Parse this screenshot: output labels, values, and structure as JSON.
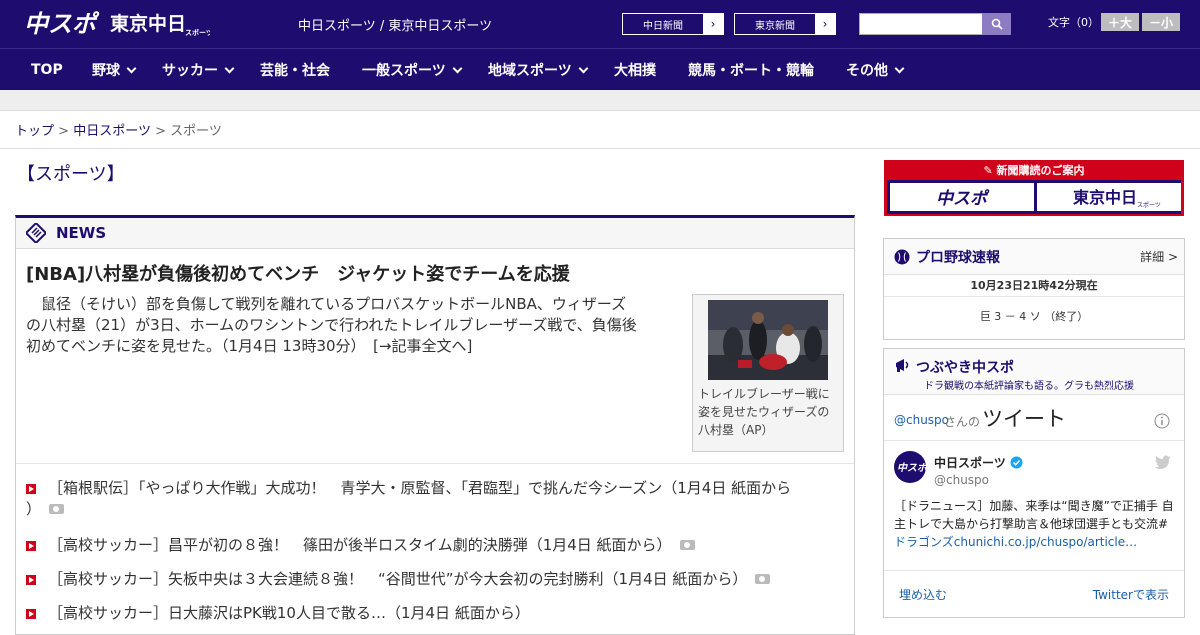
{
  "header": {
    "logo_chuspo": "中スポ",
    "logo_tokyo_main": "東京中日",
    "logo_tokyo_sub": "スポーツ",
    "site_title": "中日スポーツ / 東京中日スポーツ",
    "paper_links": [
      "中日新聞",
      "東京新聞"
    ],
    "search_placeholder": "",
    "font_size_label": "文字（0）",
    "font_plus": "＋大",
    "font_minus": "－小"
  },
  "nav": [
    {
      "label": "TOP",
      "has_menu": false
    },
    {
      "label": "野球",
      "has_menu": true
    },
    {
      "label": "サッカー",
      "has_menu": true
    },
    {
      "label": "芸能・社会",
      "has_menu": false
    },
    {
      "label": "一般スポーツ",
      "has_menu": true
    },
    {
      "label": "地域スポーツ",
      "has_menu": true
    },
    {
      "label": "大相撲",
      "has_menu": false
    },
    {
      "label": "競馬・ボート・競輪",
      "has_menu": false
    },
    {
      "label": "その他",
      "has_menu": true
    }
  ],
  "breadcrumb": {
    "items": [
      "トップ",
      "中日スポーツ",
      "スポーツ"
    ],
    "separator": ">"
  },
  "page_heading": "【スポーツ】",
  "news": {
    "section_label": "NEWS",
    "headline": "[NBA]八村塁が負傷後初めてベンチ　ジャケット姿でチームを応援",
    "lead_line1": "　鼠径（そけい）部を負傷して戦列を離れているプロバスケットボールNBA、ウィザーズ",
    "lead_line2": "の八村塁（21）が3日、ホームのワシントンで行われたトレイルブレーザーズ戦で、負傷後",
    "lead_line3": "初めてベンチに姿を見せた。（1月4日 13時30分）　[→記事全文へ]",
    "photo_caption_1": "トレイルブレーザー戦に",
    "photo_caption_2": "姿を見せたウィザーズの",
    "photo_caption_3": "八村塁（AP）",
    "articles": [
      {
        "line1": "［箱根駅伝］「やっぱり大作戦」大成功！　青学大・原監督、「君臨型」で挑んだ今シーズン（1月4日 紙面から",
        "line2": "）",
        "photo": true
      },
      {
        "line1": "［高校サッカー］昌平が初の８強！　篠田が後半ロスタイム劇的決勝弾（1月4日 紙面から）",
        "line2": "",
        "photo": true
      },
      {
        "line1": "［高校サッカー］矢板中央は３大会連続８強！　“谷間世代”が今大会初の完封勝利（1月4日 紙面から）",
        "line2": "",
        "photo": true
      },
      {
        "line1": "［高校サッカー］日大藤沢はPK戦10人目で散る…（1月4日 紙面から）",
        "line2": "",
        "photo": false
      }
    ]
  },
  "promo": {
    "title": "新聞購読のご案内",
    "left": "中スポ",
    "right": "東京中日",
    "right_sub": "スポーツ"
  },
  "baseball": {
    "title": "プロ野球速報",
    "detail": "詳細 >",
    "timestamp": "10月23日21時42分現在",
    "score": "巨 3 － 4 ソ （終了）"
  },
  "tweets": {
    "title": "つぶやき中スポ",
    "subtitle": "ドラ観戦の本紙評論家も語る。グラも熱烈応援",
    "handle_prefix": "@chuspo",
    "handle_suffix": "さんの",
    "heading": "ツイート",
    "account_name": "中日スポーツ",
    "account_handle": "@chuspo",
    "tweet_line1": "［ドラニュース］加藤、来季は“聞き魔”で正捕手 自",
    "tweet_line2": "主トレで大島から打撃助言＆他球団選手とも交流#",
    "tweet_link": "ドラゴンズchunichi.co.jp/chuspo/article…",
    "embed": "埋め込む",
    "view_on": "Twitterで表示"
  },
  "colors": {
    "brand_navy": "#1e0d6e",
    "accent_red": "#d0021b",
    "search_purple": "#8e7cc3",
    "link_blue": "#1b5fa8"
  }
}
